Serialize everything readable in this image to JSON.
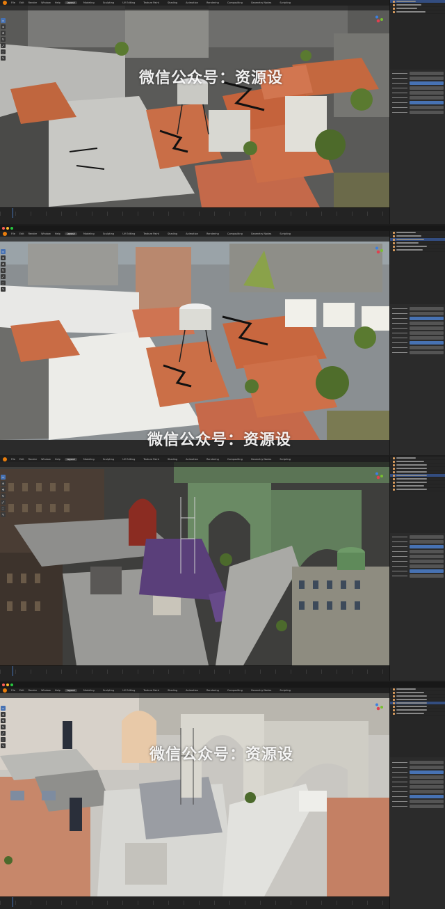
{
  "app": {
    "brand_color": "#e87d0d",
    "accent": "#4772b3"
  },
  "watermark": {
    "text": "微信公众号：资源设"
  },
  "shots": [
    {
      "title": "",
      "menu": [
        "File",
        "Edit",
        "Render",
        "Window",
        "Help"
      ],
      "workspaces": [
        "Layout",
        "Modeling",
        "Sculpting",
        "UV Editing",
        "Texture Paint",
        "Shading",
        "Animation",
        "Rendering",
        "Compositing",
        "Geometry Nodes",
        "Scripting"
      ],
      "active_workspace": "Layout"
    },
    {
      "title": "",
      "menu": [
        "File",
        "Edit",
        "Render",
        "Window",
        "Help"
      ],
      "workspaces": [
        "Layout",
        "Modeling",
        "Sculpting",
        "UV Editing",
        "Texture Paint",
        "Shading",
        "Animation",
        "Rendering",
        "Compositing",
        "Geometry Nodes",
        "Scripting"
      ],
      "active_workspace": "Layout"
    },
    {
      "title": "",
      "menu": [
        "File",
        "Edit",
        "Render",
        "Window",
        "Help"
      ],
      "workspaces": [
        "Layout",
        "Modeling",
        "Sculpting",
        "UV Editing",
        "Texture Paint",
        "Shading",
        "Animation",
        "Rendering",
        "Compositing",
        "Geometry Nodes",
        "Scripting"
      ],
      "active_workspace": "Layout"
    },
    {
      "title": "",
      "menu": [
        "File",
        "Edit",
        "Render",
        "Window",
        "Help"
      ],
      "workspaces": [
        "Layout",
        "Modeling",
        "Sculpting",
        "UV Editing",
        "Texture Paint",
        "Shading",
        "Animation",
        "Rendering",
        "Compositing",
        "Geometry Nodes",
        "Scripting"
      ],
      "active_workspace": "Layout"
    }
  ],
  "tools": [
    "select-icon",
    "cursor-icon",
    "move-icon",
    "rotate-icon",
    "scale-icon",
    "transform-icon",
    "annotate-icon",
    "measure-icon",
    "add-cube-icon"
  ],
  "tool_glyphs": [
    "▭",
    "⊕",
    "✥",
    "↻",
    "⤢",
    "⬚",
    "✎",
    "📏",
    "▣"
  ]
}
